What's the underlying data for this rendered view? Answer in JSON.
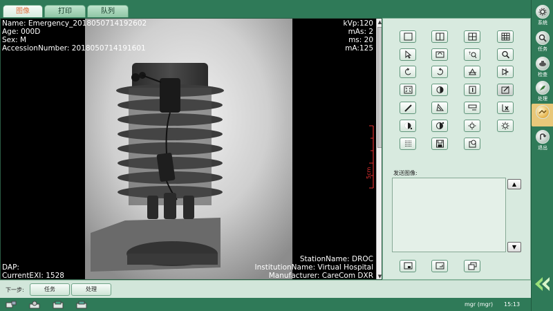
{
  "tabs": [
    {
      "label": "图像",
      "active": true
    },
    {
      "label": "打印",
      "active": false
    },
    {
      "label": "队列",
      "active": false
    }
  ],
  "overlay": {
    "top_left": [
      "Name: Emergency_20180507141926​02",
      "Age: 000D",
      "Sex: M",
      "AccessionNumber: 201805071419160​1"
    ],
    "top_right": [
      "kVp:120",
      "mAs: 2",
      "ms: 20",
      "mA:125"
    ],
    "bottom_left": [
      "DAP:",
      "CurrentEXI: 1528"
    ],
    "bottom_right": [
      "StationName: DROC",
      "InstitutionName: Virtual Hospital",
      "Manufacturer: CareCom DXR"
    ],
    "ruler_label": "5cm"
  },
  "tools": [
    "layout-1x1-icon",
    "layout-1x2-icon",
    "layout-2x2-icon",
    "layout-grid-icon",
    "pointer-icon",
    "pan-icon",
    "zoom-region-icon",
    "magnify-icon",
    "rotate-left-icon",
    "rotate-right-icon",
    "flip-vertical-icon",
    "flip-horizontal-icon",
    "fit-window-icon",
    "invert-icon",
    "info-icon",
    "annotation-icon",
    "ruler-icon",
    "angle-icon",
    "roi-icon",
    "clear-annotation-icon",
    "contrast-down-icon",
    "contrast-up-icon",
    "brightness-down-icon",
    "brightness-up-icon",
    "grid-view-icon",
    "save-icon",
    "export-icon"
  ],
  "send_panel": {
    "label": "发送图像:",
    "scroll_up": "▲",
    "scroll_down": "▼"
  },
  "step_bar": {
    "label": "下一步:",
    "buttons": [
      "任务",
      "处理"
    ]
  },
  "status": {
    "user": "mgr (mgr)",
    "time": "15:13"
  },
  "sidenav": [
    {
      "label": "系统",
      "icon": "settings-icon"
    },
    {
      "label": "任务",
      "icon": "search-task-icon"
    },
    {
      "label": "检查",
      "icon": "exam-icon"
    },
    {
      "label": "处理",
      "icon": "process-icon"
    },
    {
      "label": "",
      "icon": "image-icon",
      "active": true
    },
    {
      "label": "退出",
      "icon": "exit-icon"
    }
  ],
  "colors": {
    "theme_dark": "#2f7a58",
    "panel": "#d8eadf",
    "active_tab_text": "#e07040",
    "ruler": "#e03030"
  }
}
